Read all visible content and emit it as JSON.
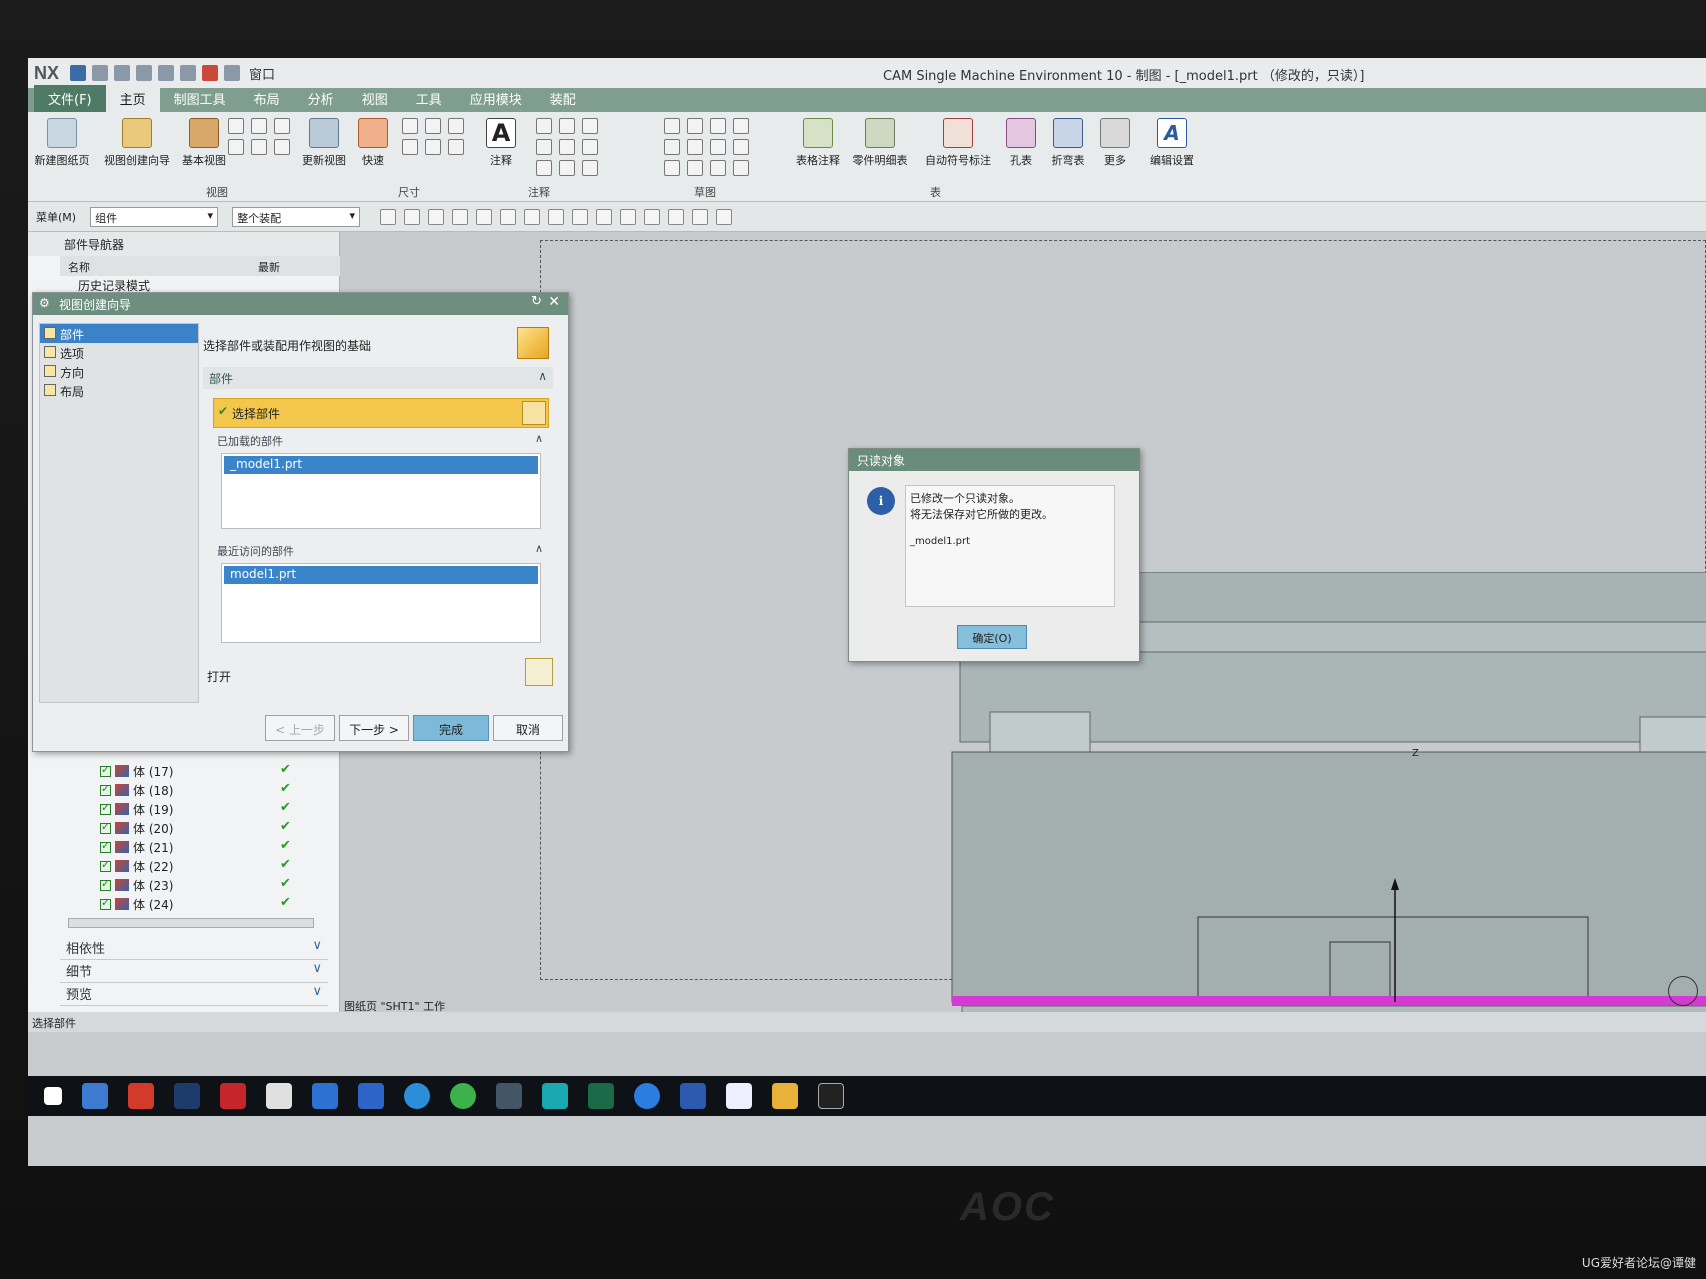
{
  "titlebar": {
    "logo": "NX",
    "window_menu": "窗口",
    "title": "CAM Single Machine Environment 10 - 制图 - [_model1.prt （修改的，只读）]"
  },
  "ribbon": {
    "tabs": [
      "文件(F)",
      "主页",
      "制图工具",
      "布局",
      "分析",
      "视图",
      "工具",
      "应用模块",
      "装配"
    ],
    "active_tab": "主页",
    "buttons": {
      "new_sheet": "新建图纸页",
      "view_wizard": "视图创建向导",
      "base_view": "基本视图",
      "update_view": "更新视图",
      "quick": "快速",
      "note": "注释",
      "table_note": "表格注释",
      "parts_list": "零件明细表",
      "auto_balloon": "自动符号标注",
      "hole_table": "孔表",
      "bend_table": "折弯表",
      "more": "更多",
      "edit_settings": "编辑设置"
    },
    "groups": {
      "view": "视图",
      "dimension": "尺寸",
      "annotation": "注释",
      "sketch": "草图",
      "table": "表"
    }
  },
  "toolbar2": {
    "menu": "菜单(M)",
    "filter_value": "组件",
    "scope_value": "整个装配"
  },
  "navigator": {
    "title": "部件导航器",
    "col_name": "名称",
    "col_latest": "最新",
    "history_mode": "历史记录模式",
    "bodies": [
      "体 (17)",
      "体 (18)",
      "体 (19)",
      "体 (20)",
      "体 (21)",
      "体 (22)",
      "体 (23)",
      "体 (24)"
    ],
    "sections": [
      "相依性",
      "细节",
      "预览"
    ]
  },
  "wizard": {
    "title": "视图创建向导",
    "steps": [
      "部件",
      "选项",
      "方向",
      "布局"
    ],
    "active_step": "部件",
    "hint": "选择部件或装配用作视图的基础",
    "section_part": "部件",
    "select_part": "选择部件",
    "loaded_parts_label": "已加载的部件",
    "loaded_parts": [
      "_model1.prt"
    ],
    "recent_parts_label": "最近访问的部件",
    "recent_parts": [
      "model1.prt"
    ],
    "open_label": "打开",
    "buttons": {
      "back": "< 上一步",
      "next": "下一步 >",
      "finish": "完成",
      "cancel": "取消"
    }
  },
  "message": {
    "title": "只读对象",
    "line1": "已修改一个只读对象。",
    "line2": "将无法保存对它所做的更改。",
    "file": "_model1.prt",
    "ok": "确定(O)"
  },
  "canvas": {
    "status": "图纸页 \"SHT1\" 工作",
    "axis_label": "Z"
  },
  "statusbar": {
    "text": "选择部件"
  },
  "bezel": {
    "brand": "AOC"
  },
  "watermark": "UG爱好者论坛@谭健"
}
